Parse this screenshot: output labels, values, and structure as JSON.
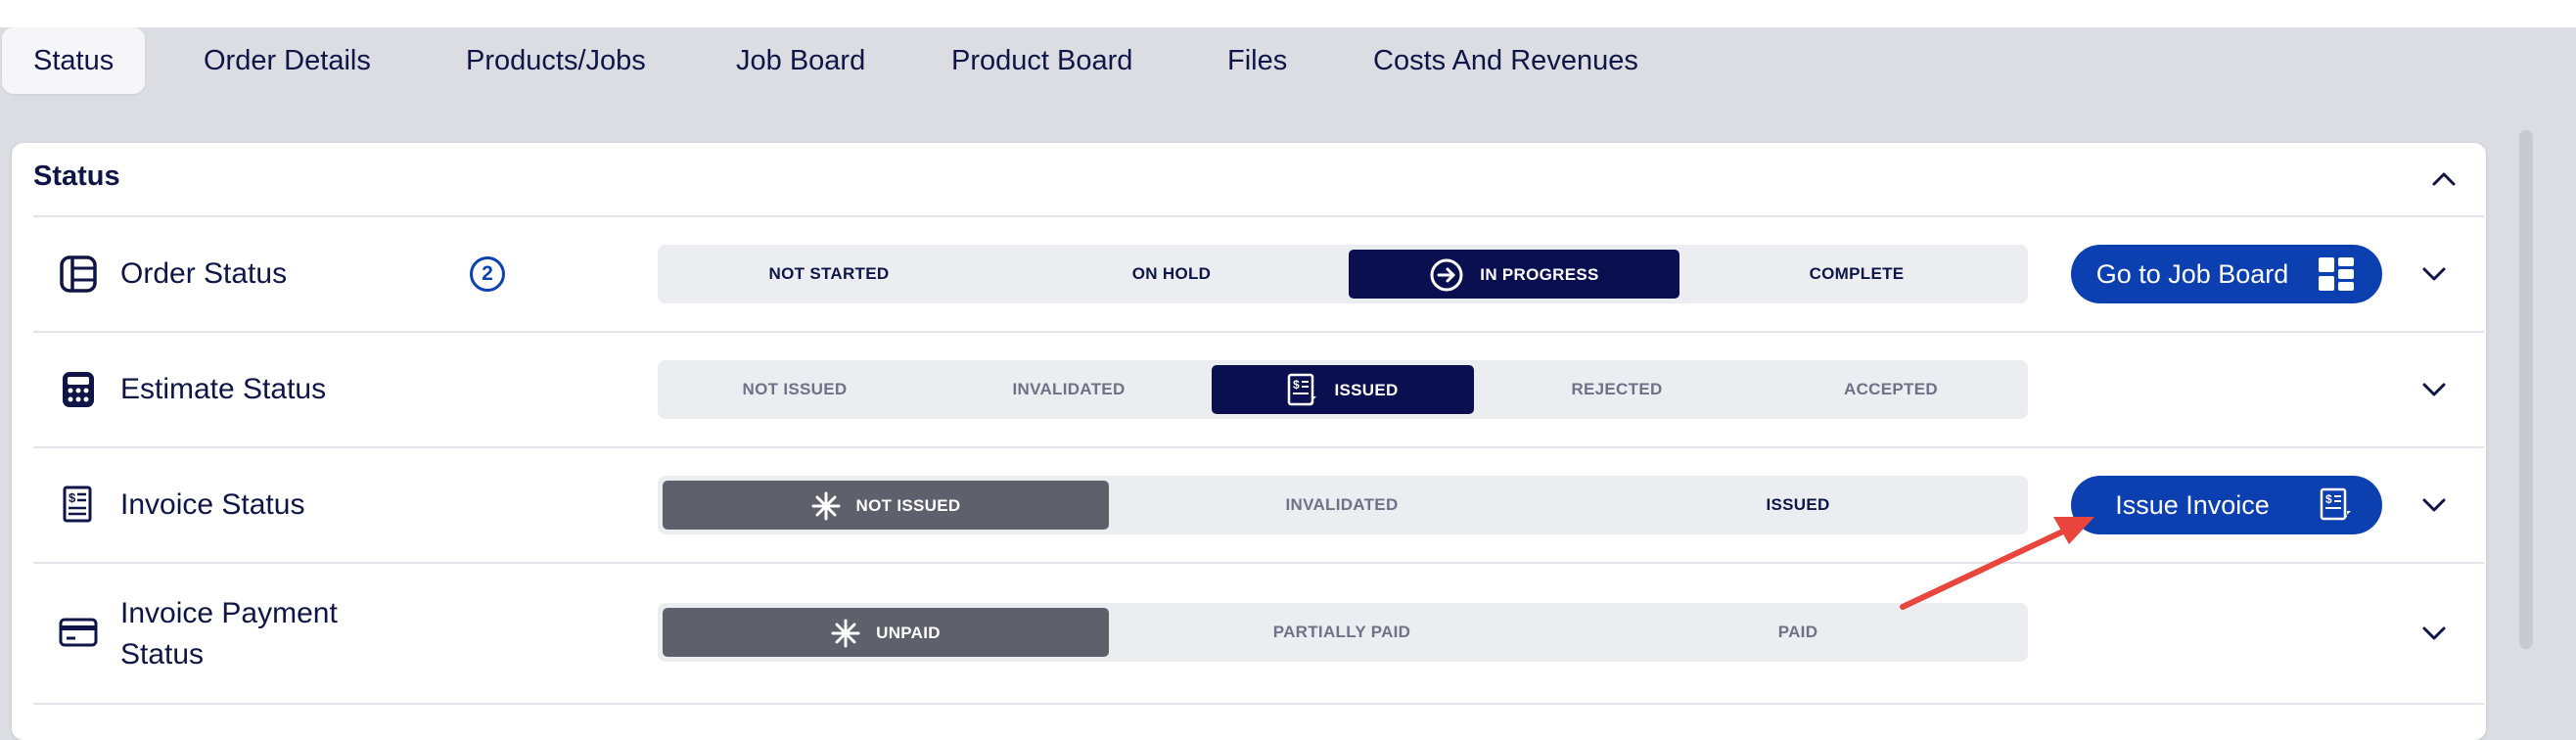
{
  "tabs": [
    {
      "label": "Status",
      "active": true
    },
    {
      "label": "Order Details"
    },
    {
      "label": "Products/Jobs"
    },
    {
      "label": "Job Board"
    },
    {
      "label": "Product Board"
    },
    {
      "label": "Files"
    },
    {
      "label": "Costs And Revenues"
    }
  ],
  "panel": {
    "title": "Status"
  },
  "order_status": {
    "label": "Order Status",
    "count": "2",
    "options": [
      "NOT STARTED",
      "ON HOLD",
      "IN PROGRESS",
      "COMPLETE"
    ],
    "selected": "IN PROGRESS",
    "button": "Go to Job Board"
  },
  "estimate_status": {
    "label": "Estimate Status",
    "options": [
      "NOT ISSUED",
      "INVALIDATED",
      "ISSUED",
      "REJECTED",
      "ACCEPTED"
    ],
    "selected": "ISSUED"
  },
  "invoice_status": {
    "label": "Invoice Status",
    "options": [
      "NOT ISSUED",
      "INVALIDATED",
      "ISSUED"
    ],
    "selected": "NOT ISSUED",
    "button": "Issue Invoice"
  },
  "invoice_payment_status": {
    "label_line1": "Invoice Payment",
    "label_line2": "Status",
    "options": [
      "UNPAID",
      "PARTIALLY PAID",
      "PAID"
    ],
    "selected": "UNPAID"
  },
  "colors": {
    "accent_blue": "#0c3fb0",
    "navy_selected": "#0a0f4f",
    "gray_selected": "#5e606c",
    "annotation_arrow": "#e8453c"
  }
}
